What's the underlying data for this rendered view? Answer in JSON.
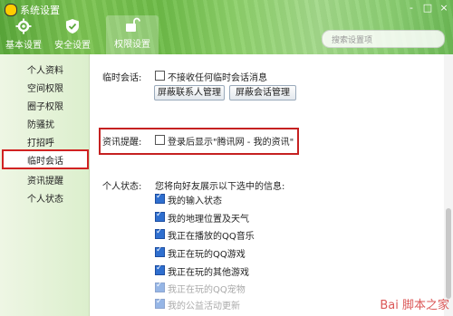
{
  "window": {
    "title": "系统设置",
    "controls": [
      "-",
      "□",
      "×"
    ]
  },
  "tabs": [
    {
      "label": "基本设置",
      "icon": "gear-icon"
    },
    {
      "label": "安全设置",
      "icon": "shield-icon"
    },
    {
      "label": "权限设置",
      "icon": "unlock-icon"
    }
  ],
  "search": {
    "placeholder": "搜索设置项"
  },
  "sidebar": {
    "items": [
      "个人资料",
      "空间权限",
      "圈子权限",
      "防骚扰",
      "打招呼",
      "临时会话",
      "资讯提醒",
      "个人状态"
    ],
    "active_index": 5
  },
  "temp_session": {
    "label": "临时会话:",
    "option": "不接收任何临时会话消息",
    "btn1": "屏蔽联系人管理",
    "btn2": "屏蔽会话管理"
  },
  "news": {
    "label": "资讯提醒:",
    "option": "登录后显示\"腾讯网 - 我的资讯\""
  },
  "status": {
    "label": "个人状态:",
    "desc": "您将向好友展示以下选中的信息:",
    "items": [
      "我的输入状态",
      "我的地理位置及天气",
      "我正在播放的QQ音乐",
      "我正在玩的QQ游戏",
      "我正在玩的其他游戏",
      "我正在玩的QQ宠物",
      "我的公益活动更新"
    ]
  },
  "watermark": "Bai 脚本之家"
}
